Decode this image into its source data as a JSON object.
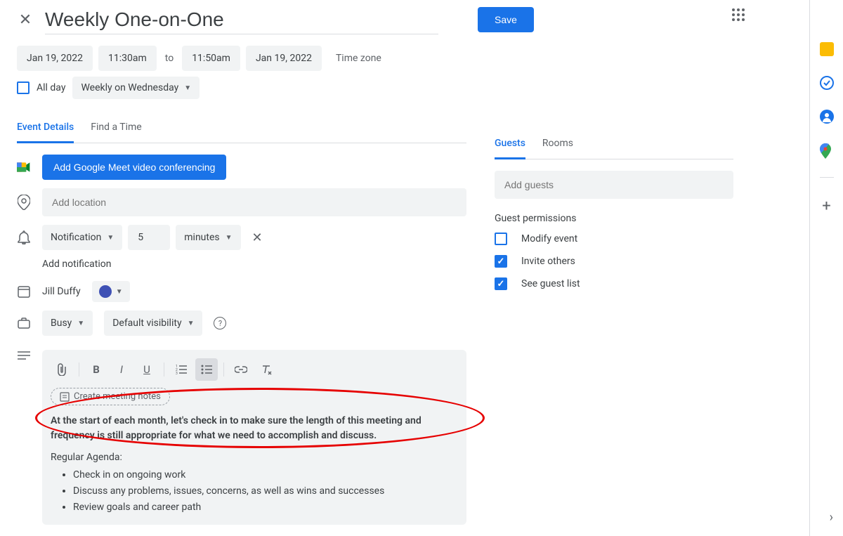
{
  "title": "Weekly One-on-One",
  "save_label": "Save",
  "date_start": "Jan 19, 2022",
  "time_start": "11:30am",
  "to_label": "to",
  "time_end": "11:50am",
  "date_end": "Jan 19, 2022",
  "timezone_label": "Time zone",
  "allday_label": "All day",
  "recurrence": "Weekly on Wednesday",
  "tabs": {
    "details": "Event Details",
    "findtime": "Find a Time",
    "guests": "Guests",
    "rooms": "Rooms"
  },
  "meet_button": "Add Google Meet video conferencing",
  "location_placeholder": "Add location",
  "notification": {
    "type": "Notification",
    "value": "5",
    "unit": "minutes"
  },
  "add_notification": "Add notification",
  "owner": "Jill Duffy",
  "availability": "Busy",
  "visibility": "Default visibility",
  "create_notes": "Create meeting notes",
  "description": {
    "bold_text": "At the start of each month, let's check in to make sure the length of this meeting and frequency is still appropriate for what we need to accomplish and discuss.",
    "agenda_header": "Regular Agenda:",
    "agenda_items": [
      "Check in on ongoing work",
      "Discuss any problems, issues, concerns, as well as wins and successes",
      "Review goals and career path"
    ]
  },
  "guests_placeholder": "Add guests",
  "permissions_title": "Guest permissions",
  "permissions": {
    "modify": "Modify event",
    "invite": "Invite others",
    "seelist": "See guest list"
  }
}
